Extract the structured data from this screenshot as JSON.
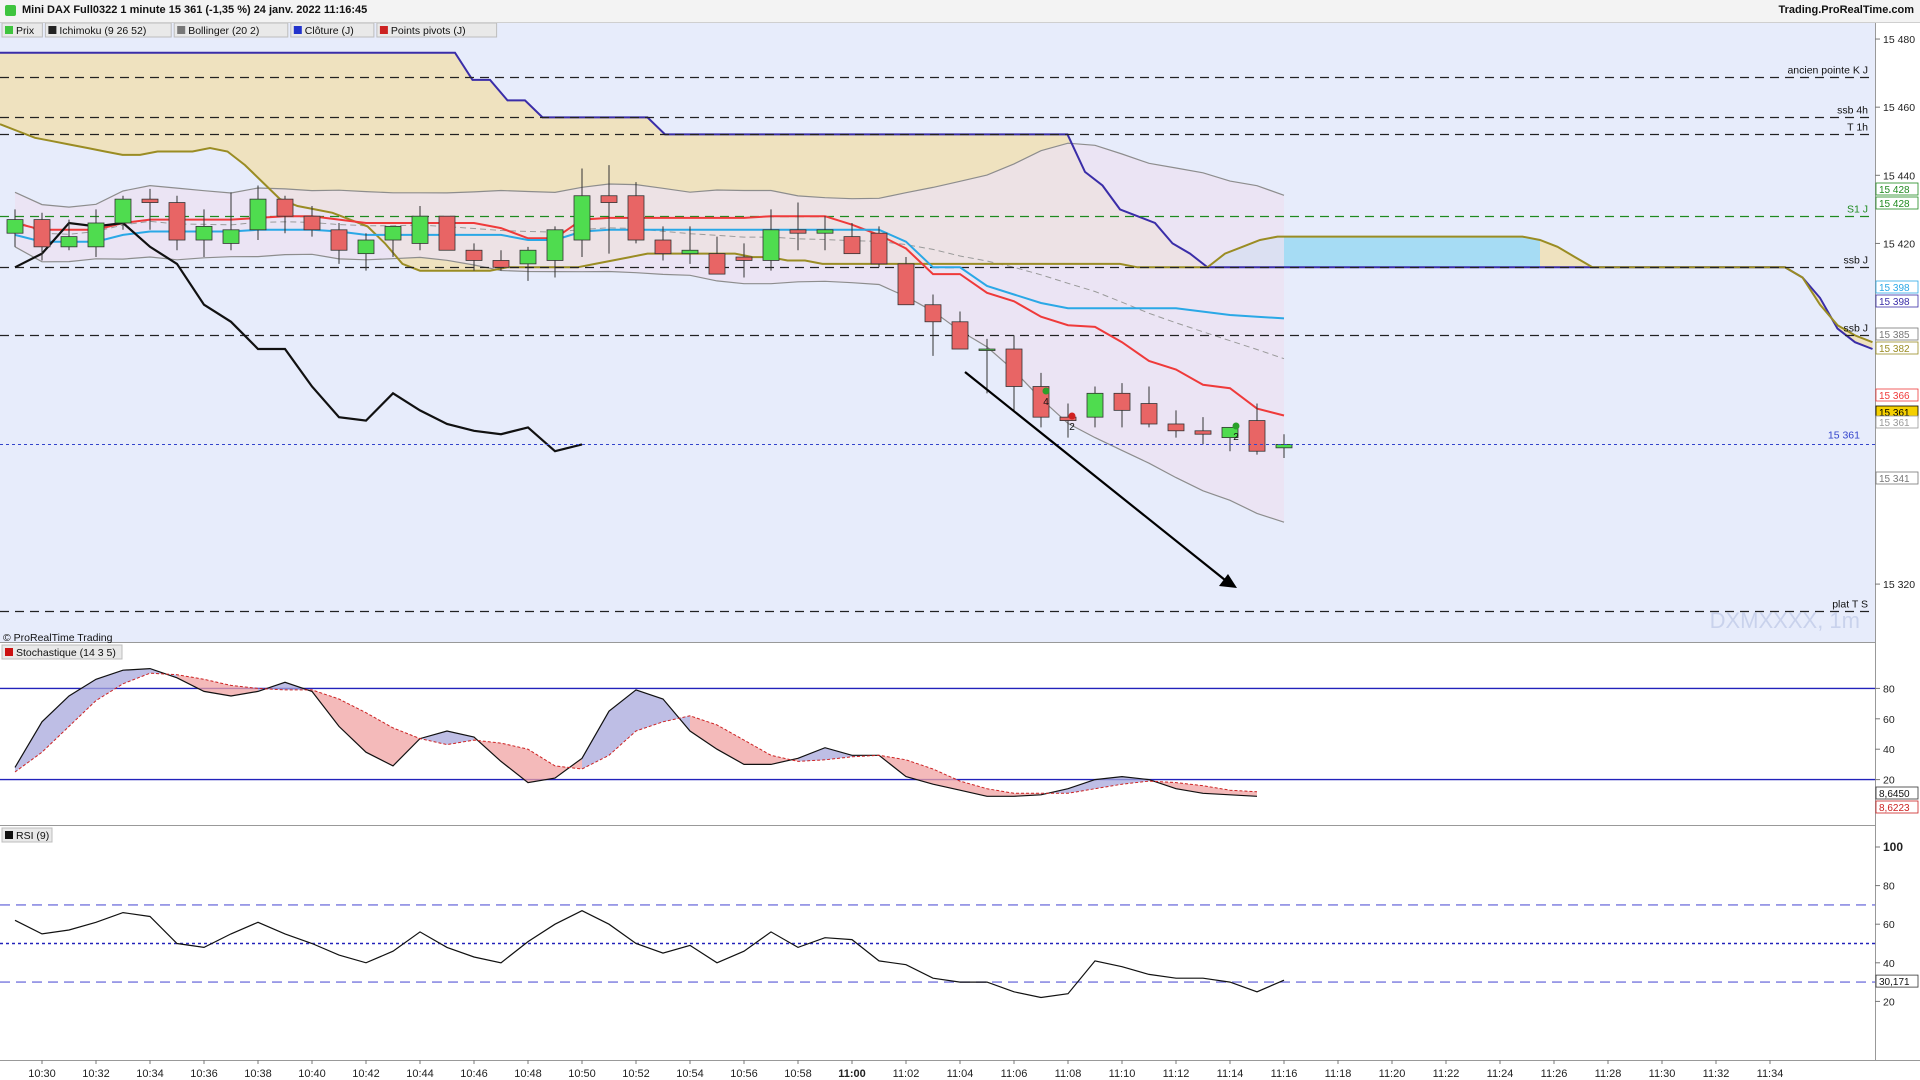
{
  "window": {
    "title": "Mini DAX Full0322 1 minute 15 361 (-1,35 %) 24 janv. 2022 11:16:45",
    "brand": "Trading.ProRealTime.com"
  },
  "legend": [
    {
      "label": "Prix",
      "color": "#3ec43e"
    },
    {
      "label": "Ichimoku (9 26 52)",
      "color": "#222222"
    },
    {
      "label": "Bollinger (20 2)",
      "color": "#777777"
    },
    {
      "label": "Clôture (J)",
      "color": "#2233cc"
    },
    {
      "label": "Points pivots (J)",
      "color": "#cc2222"
    }
  ],
  "watermark": "DXMXXXX, 1m",
  "credit": "© ProRealTime Trading",
  "colors": {
    "bull": "#4fdc4f",
    "bear": "#e86565",
    "price_bg": "#e7ecfb",
    "kumo_tan": "#efe2bf",
    "kumo_blue": "#a6dcf4",
    "boll_fill": "#ece2f1",
    "tenkan": "#ef3a3a",
    "kijun": "#2aa8e6",
    "chikou": "#111111",
    "ssa": "#3a2da8",
    "ssb": "#9a8c23"
  },
  "levels": [
    {
      "label": "ancien pointe K J",
      "price": 15469
    },
    {
      "label": "ssb 4h",
      "price": 15457
    },
    {
      "label": "T 1h",
      "price": 15452
    },
    {
      "label": "S1 J",
      "price": 15428
    },
    {
      "label": "ssb J",
      "price": 15413
    },
    {
      "label": "ssb J",
      "price": 15393
    },
    {
      "label": "plat T S",
      "price": 15312
    }
  ],
  "current_price_label": "15 361",
  "price_axis_ticks": [
    "15 480",
    "15 460",
    "15 440",
    "15 420",
    "15 320"
  ],
  "price_tags": [
    "15 428",
    "15 428",
    "15 398",
    "15 398",
    "15 385",
    "15 382",
    "15 366",
    "15 361",
    "15 361",
    "15 341"
  ],
  "time_ticks": [
    "10:30",
    "10:32",
    "10:34",
    "10:36",
    "10:38",
    "10:40",
    "10:42",
    "10:44",
    "10:46",
    "10:48",
    "10:50",
    "10:52",
    "10:54",
    "10:56",
    "10:58",
    "11:00",
    "11:02",
    "11:04",
    "11:06",
    "11:08",
    "11:10",
    "11:12",
    "11:14",
    "11:16",
    "11:18",
    "11:20",
    "11:22",
    "11:24",
    "11:26",
    "11:28",
    "11:30",
    "11:32",
    "11:34"
  ],
  "stoch": {
    "label": "Stochastique (14 3 5)",
    "ticks": [
      "80",
      "60",
      "40",
      "20"
    ],
    "value_k": "8,6450",
    "value_d": "8,6223"
  },
  "rsi": {
    "label": "RSI (9)",
    "ticks": [
      "100",
      "80",
      "60",
      "40",
      "20"
    ],
    "value": "30,171"
  },
  "markers": [
    "4",
    "2",
    "2"
  ],
  "chart_data": {
    "type": "candlestick",
    "title": "Mini DAX Full0322 1 minute",
    "interval": "1 minute",
    "date": "24 janv. 2022",
    "ylim": [
      15303,
      15485
    ],
    "x": [
      "10:29",
      "10:30",
      "10:31",
      "10:32",
      "10:33",
      "10:34",
      "10:35",
      "10:36",
      "10:37",
      "10:38",
      "10:39",
      "10:40",
      "10:41",
      "10:42",
      "10:43",
      "10:44",
      "10:45",
      "10:46",
      "10:47",
      "10:48",
      "10:49",
      "10:50",
      "10:51",
      "10:52",
      "10:53",
      "10:54",
      "10:55",
      "10:56",
      "10:57",
      "10:58",
      "10:59",
      "11:00",
      "11:01",
      "11:02",
      "11:03",
      "11:04",
      "11:05",
      "11:06",
      "11:07",
      "11:08",
      "11:09",
      "11:10",
      "11:11",
      "11:12",
      "11:13",
      "11:14",
      "11:15",
      "11:16"
    ],
    "open": [
      15423,
      15427,
      15419,
      15419,
      15426,
      15433,
      15432,
      15421,
      15420,
      15424,
      15433,
      15428,
      15424,
      15417,
      15421,
      15420,
      15428,
      15418,
      15415,
      15414,
      15415,
      15421,
      15434,
      15434,
      15421,
      15417,
      15417,
      15416,
      15415,
      15424,
      15423,
      15422,
      15423,
      15414,
      15402,
      15397,
      15389,
      15389,
      15378,
      15369,
      15369,
      15376,
      15373,
      15367,
      15365,
      15363,
      15368,
      15360
    ],
    "high": [
      15430,
      15429,
      15427,
      15430,
      15434,
      15436,
      15434,
      15430,
      15435,
      15437,
      15434,
      15431,
      15426,
      15423,
      15425,
      15431,
      15428,
      15420,
      15418,
      15419,
      15425,
      15442,
      15443,
      15438,
      15425,
      15425,
      15422,
      15420,
      15430,
      15432,
      15428,
      15426,
      15425,
      15416,
      15405,
      15400,
      15392,
      15393,
      15382,
      15373,
      15378,
      15379,
      15378,
      15371,
      15369,
      15366,
      15373,
      15364
    ],
    "low": [
      15419,
      15415,
      15418,
      15416,
      15424,
      15424,
      15418,
      15416,
      15418,
      15421,
      15423,
      15422,
      15414,
      15412,
      15416,
      15418,
      15418,
      15412,
      15412,
      15409,
      15410,
      15416,
      15417,
      15420,
      15415,
      15414,
      15412,
      15410,
      15412,
      15418,
      15418,
      15418,
      15413,
      15402,
      15387,
      15390,
      15376,
      15371,
      15366,
      15363,
      15366,
      15366,
      15366,
      15363,
      15361,
      15359,
      15358,
      15357
    ],
    "close": [
      15427,
      15419,
      15422,
      15426,
      15433,
      15432,
      15421,
      15425,
      15424,
      15433,
      15428,
      15424,
      15418,
      15421,
      15425,
      15428,
      15418,
      15415,
      15413,
      15418,
      15424,
      15434,
      15432,
      15421,
      15417,
      15418,
      15411,
      15415,
      15424,
      15423,
      15424,
      15417,
      15414,
      15402,
      15397,
      15389,
      15389,
      15378,
      15369,
      15368,
      15376,
      15371,
      15367,
      15365,
      15364,
      15366,
      15359,
      15361
    ],
    "stochastic_k": [
      28,
      58,
      75,
      86,
      92,
      93,
      87,
      78,
      75,
      78,
      84,
      78,
      55,
      38,
      29,
      47,
      52,
      48,
      32,
      18,
      21,
      34,
      65,
      79,
      73,
      52,
      40,
      30,
      30,
      34,
      41,
      36,
      36,
      22,
      17,
      13,
      9,
      9,
      10,
      14,
      20,
      22,
      20,
      14,
      11,
      10,
      9
    ],
    "stochastic_d": [
      25,
      38,
      55,
      72,
      83,
      90,
      89,
      86,
      82,
      80,
      79,
      79,
      73,
      64,
      54,
      47,
      43,
      46,
      44,
      40,
      29,
      27,
      36,
      52,
      58,
      62,
      56,
      46,
      36,
      32,
      33,
      35,
      36,
      33,
      27,
      19,
      14,
      11,
      11,
      11,
      14,
      17,
      19,
      18,
      16,
      13,
      12
    ],
    "rsi": [
      62,
      55,
      57,
      61,
      66,
      64,
      50,
      48,
      55,
      61,
      55,
      50,
      44,
      40,
      46,
      56,
      48,
      43,
      40,
      51,
      60,
      67,
      60,
      50,
      45,
      49,
      40,
      46,
      56,
      48,
      53,
      52,
      41,
      39,
      32,
      30,
      30,
      25,
      22,
      24,
      41,
      38,
      34,
      32,
      32,
      30,
      25,
      31
    ]
  }
}
